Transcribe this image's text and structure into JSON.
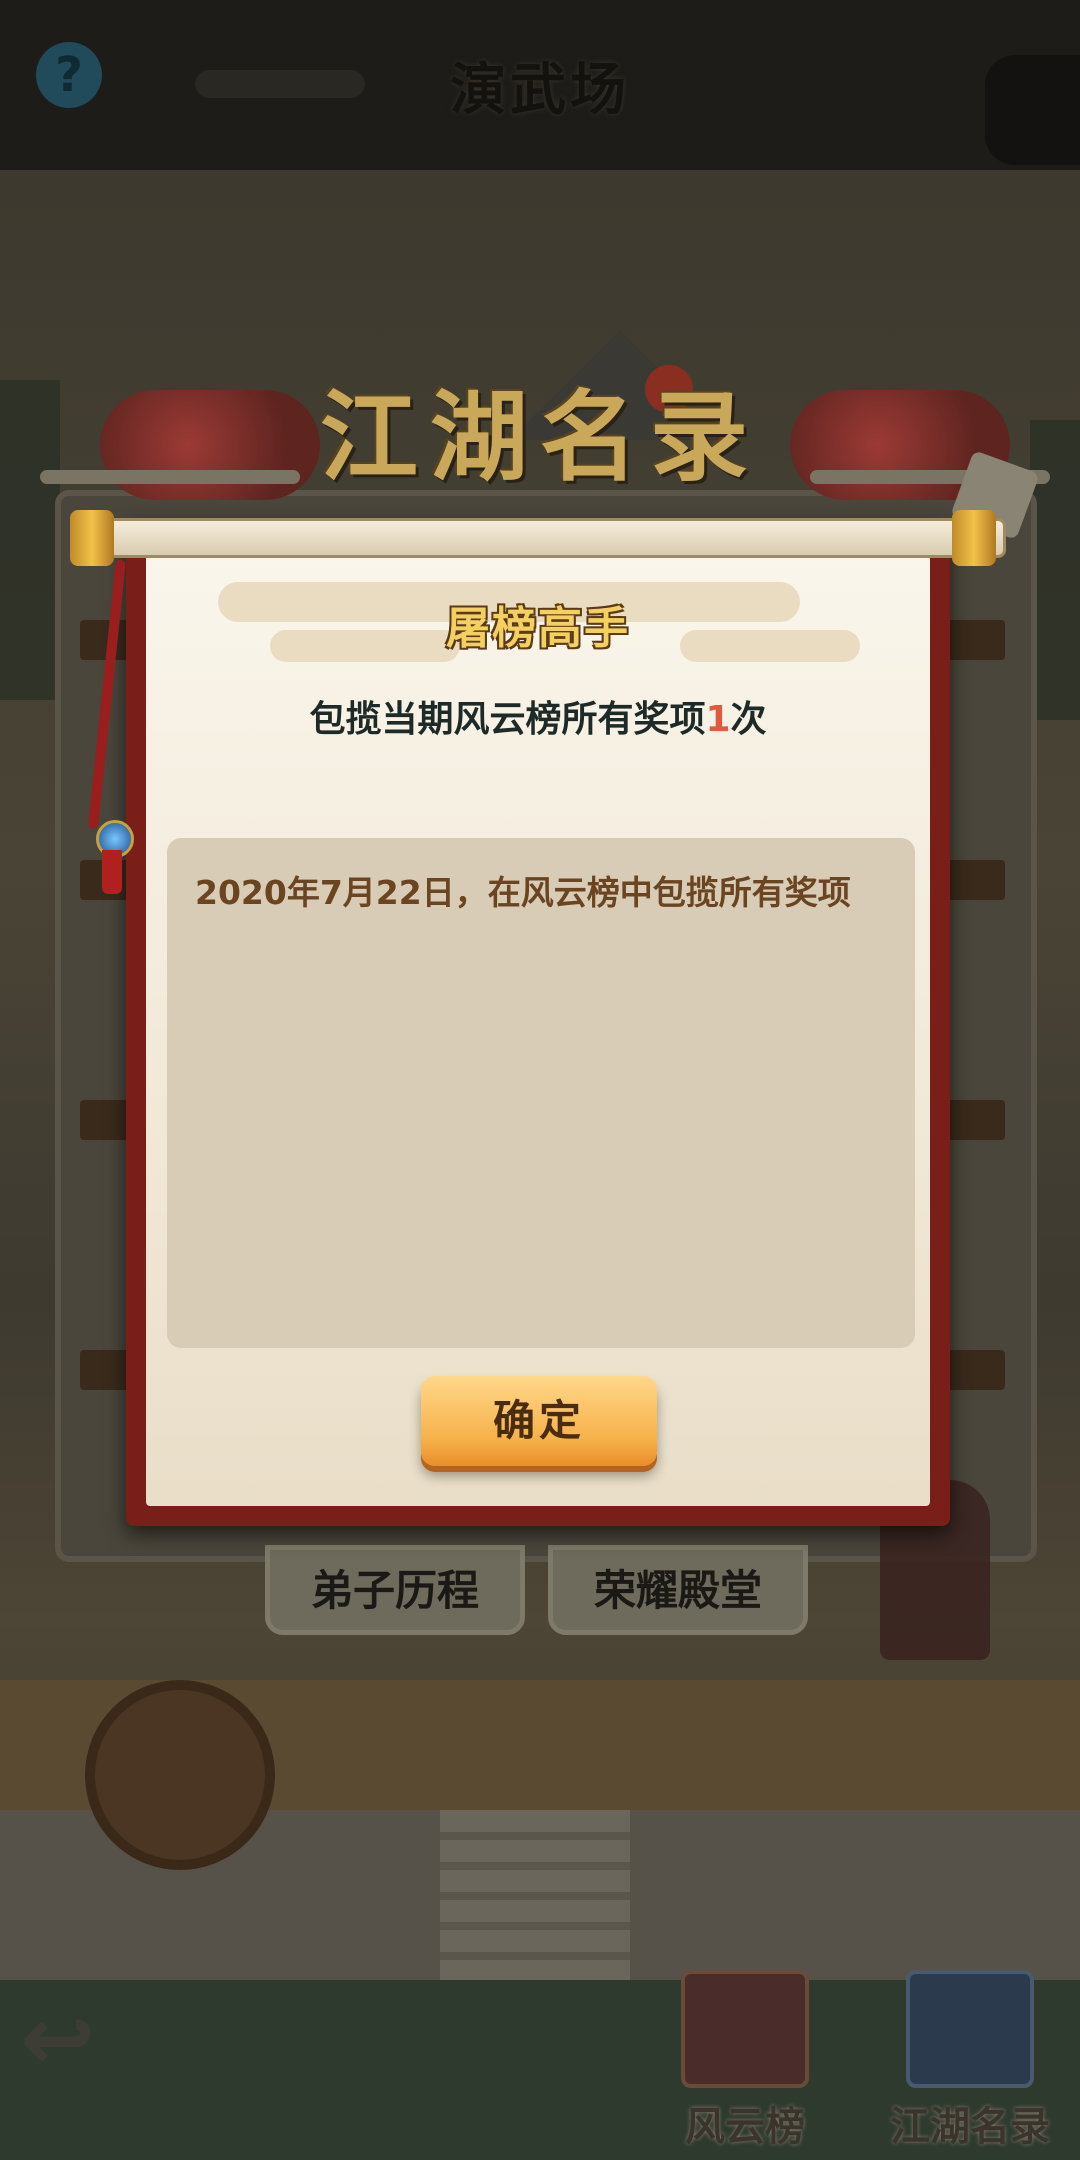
{
  "background": {
    "scene_title": "演武场",
    "help_icon_glyph": "?",
    "tabs": [
      "弟子历程",
      "荣耀殿堂"
    ],
    "bottom_nav": [
      {
        "label": "风云榜",
        "icon": "ranking-scroll-icon"
      },
      {
        "label": "江湖名录",
        "icon": "book-icon"
      }
    ]
  },
  "banner": {
    "title": "江湖名录"
  },
  "dialog": {
    "heading": "屠榜高手",
    "subtitle_prefix": "包揽当期风云榜所有奖项",
    "subtitle_count": "1",
    "subtitle_suffix": "次",
    "records": [
      "2020年7月22日，在风云榜中包揽所有奖项"
    ],
    "confirm_label": "确定"
  },
  "colors": {
    "accent_red": "#7a1e1a",
    "button_orange": "#f7b14a",
    "count_highlight": "#e05a3e"
  }
}
